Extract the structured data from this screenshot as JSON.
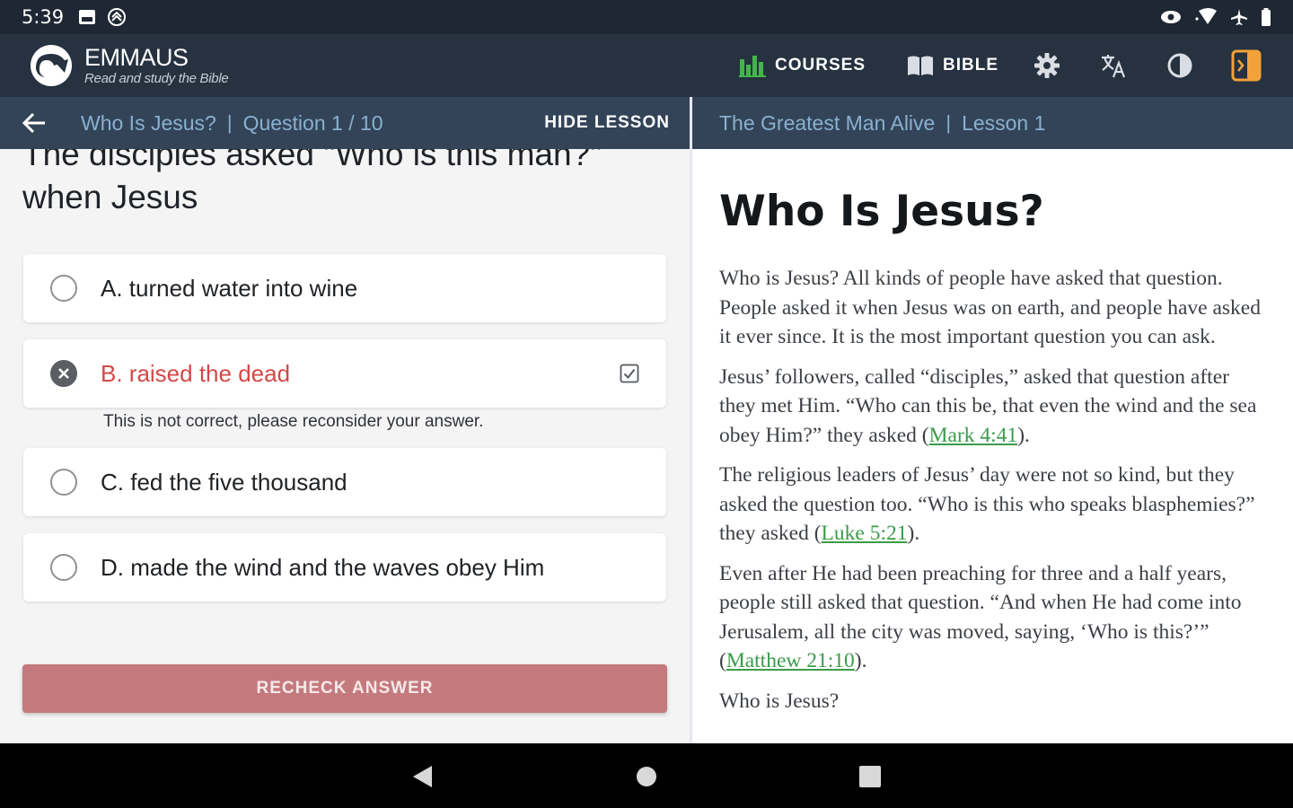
{
  "status_bar": {
    "time": "5:39"
  },
  "header": {
    "brand": "EMMAUS",
    "tagline": "Read and study the Bible",
    "nav": {
      "courses": "COURSES",
      "bible": "BIBLE"
    },
    "colors": {
      "accent_green": "#43b649",
      "accent_orange": "#f2a23a"
    }
  },
  "quiz": {
    "breadcrumb_lesson": "Who Is Jesus?",
    "breadcrumb_question": "Question 1 / 10",
    "hide_lesson_label": "HIDE LESSON",
    "question_lines": [
      "The disciples asked \"Who is this man?\"",
      "when Jesus"
    ],
    "options": [
      {
        "label": "A. turned water into wine",
        "state": "unselected"
      },
      {
        "label": "B. raised the dead",
        "state": "incorrect"
      },
      {
        "label": "C. fed the five thousand",
        "state": "unselected"
      },
      {
        "label": "D. made the wind and the waves obey Him",
        "state": "unselected"
      }
    ],
    "feedback": "This is not correct, please reconsider your answer.",
    "recheck_label": "RECHECK ANSWER"
  },
  "lesson": {
    "course_title": "The Greatest Man Alive",
    "lesson_label": "Lesson 1",
    "title": "Who Is Jesus?",
    "paragraphs": [
      {
        "text": "Who is Jesus? All kinds of people have asked that question. People asked it when Jesus was on earth, and people have asked it ever since. It is the most important question you can ask."
      },
      {
        "text_before": "Jesus’ followers, called “disciples,” asked that question after they met Him. “Who can this be, that even the wind and the sea obey Him?” they asked (",
        "link": "Mark 4:41",
        "text_after": ")."
      },
      {
        "text_before": "The religious leaders of Jesus’ day were not so kind, but they asked the question too. “Who is this who speaks blasphemies?” they asked (",
        "link": "Luke 5:21",
        "text_after": ")."
      },
      {
        "text_before": "Even after He had been preaching for three and a half years, people still asked that question. “And when He had come into Jerusalem, all the city was moved, saying, ‘Who is this?’” (",
        "link": "Matthew 21:10",
        "text_after": ")."
      },
      {
        "text": "Who is Jesus?"
      }
    ]
  }
}
